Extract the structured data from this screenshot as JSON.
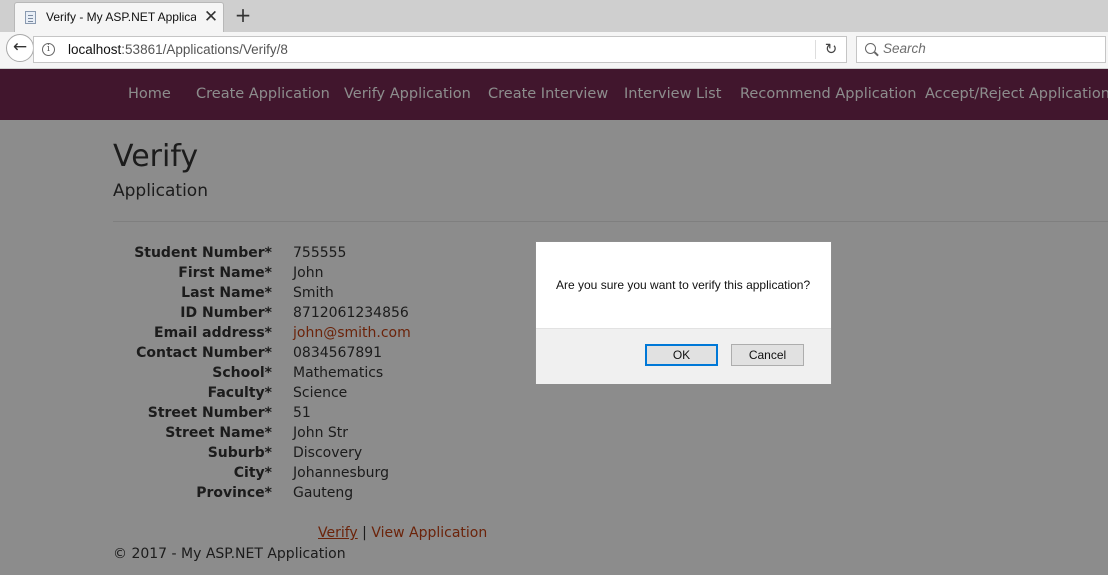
{
  "browser": {
    "tab_title": "Verify - My ASP.NET Applica",
    "tab_close": "✕",
    "new_tab": "+",
    "url_host": "localhost",
    "url_rest": ":53861/Applications/Verify/8",
    "search_placeholder": "Search",
    "back": "←",
    "reload": "↻",
    "info": "i"
  },
  "nav": {
    "items": [
      "Home",
      "Create Application",
      "Verify Application",
      "Create Interview",
      "Interview List",
      "Recommend Application",
      "Accept/Reject Application"
    ]
  },
  "page": {
    "title": "Verify",
    "subtitle": "Application",
    "fields": [
      {
        "label": "Student Number*",
        "value": "755555"
      },
      {
        "label": "First Name*",
        "value": "John"
      },
      {
        "label": "Last Name*",
        "value": "Smith"
      },
      {
        "label": "ID Number*",
        "value": "8712061234856"
      },
      {
        "label": "Email address*",
        "value": "john@smith.com"
      },
      {
        "label": "Contact Number*",
        "value": "0834567891"
      },
      {
        "label": "School*",
        "value": "Mathematics"
      },
      {
        "label": "Faculty*",
        "value": "Science"
      },
      {
        "label": "Street Number*",
        "value": "51"
      },
      {
        "label": "Street Name*",
        "value": "John Str"
      },
      {
        "label": "Suburb*",
        "value": "Discovery"
      },
      {
        "label": "City*",
        "value": "Johannesburg"
      },
      {
        "label": "Province*",
        "value": "Gauteng"
      }
    ],
    "actions": {
      "verify": "Verify",
      "separator": "|",
      "view": "View Application"
    },
    "footer": "© 2017 - My ASP.NET Application"
  },
  "dialog": {
    "message": "Are you sure you want to verify this application?",
    "ok": "OK",
    "cancel": "Cancel"
  },
  "colors": {
    "brand": "#772953",
    "link": "#c34113"
  }
}
